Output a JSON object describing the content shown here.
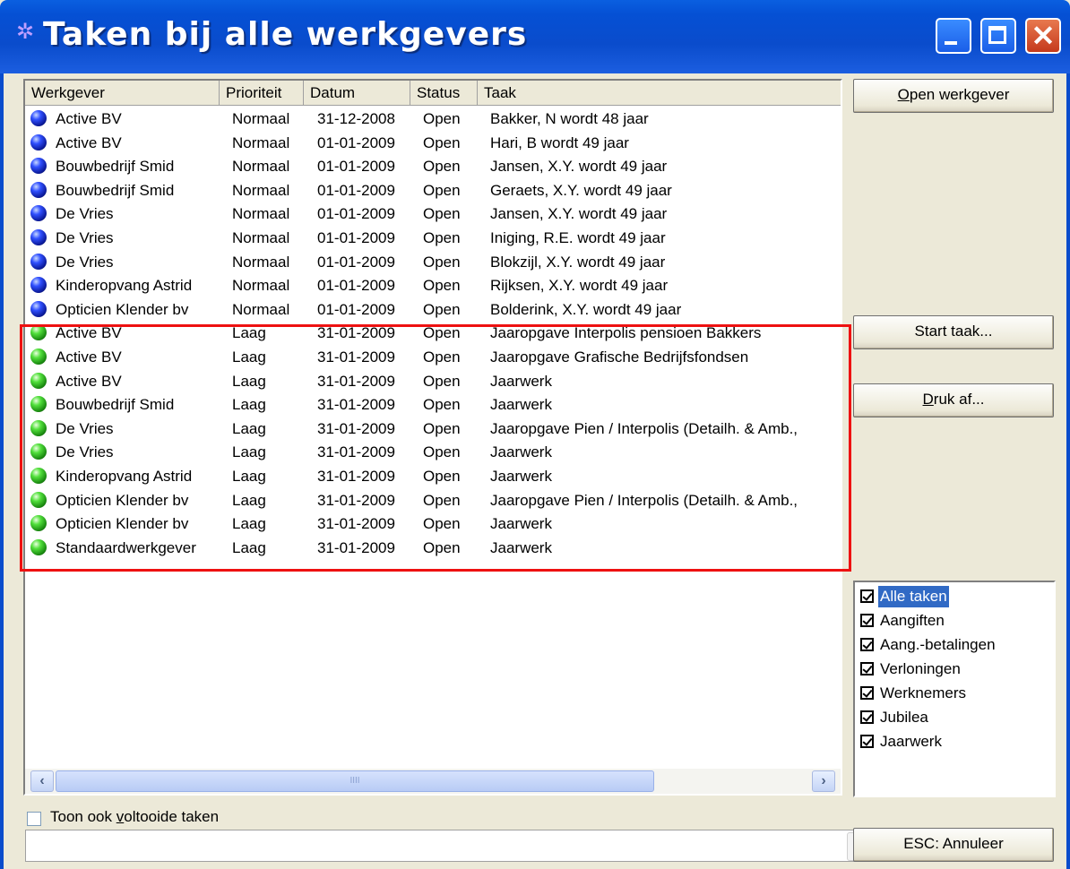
{
  "window": {
    "title": "Taken bij alle werkgevers"
  },
  "columns": [
    "Werkgever",
    "Prioriteit",
    "Datum",
    "Status",
    "Taak"
  ],
  "rows": [
    {
      "werkgever": "Active BV",
      "prioriteit": "Normaal",
      "datum": "31-12-2008",
      "status": "Open",
      "taak": "Bakker, N wordt 48 jaar",
      "icon": "blue-ball-icon"
    },
    {
      "werkgever": "Active BV",
      "prioriteit": "Normaal",
      "datum": "01-01-2009",
      "status": "Open",
      "taak": "Hari, B wordt 49 jaar",
      "icon": "blue-ball-icon"
    },
    {
      "werkgever": "Bouwbedrijf Smid",
      "prioriteit": "Normaal",
      "datum": "01-01-2009",
      "status": "Open",
      "taak": "Jansen, X.Y. wordt 49 jaar",
      "icon": "blue-ball-icon"
    },
    {
      "werkgever": "Bouwbedrijf Smid",
      "prioriteit": "Normaal",
      "datum": "01-01-2009",
      "status": "Open",
      "taak": "Geraets, X.Y. wordt 49 jaar",
      "icon": "blue-ball-icon"
    },
    {
      "werkgever": "De Vries",
      "prioriteit": "Normaal",
      "datum": "01-01-2009",
      "status": "Open",
      "taak": "Jansen, X.Y. wordt 49 jaar",
      "icon": "blue-ball-icon"
    },
    {
      "werkgever": "De Vries",
      "prioriteit": "Normaal",
      "datum": "01-01-2009",
      "status": "Open",
      "taak": "Iniging, R.E. wordt 49 jaar",
      "icon": "blue-ball-icon"
    },
    {
      "werkgever": "De Vries",
      "prioriteit": "Normaal",
      "datum": "01-01-2009",
      "status": "Open",
      "taak": "Blokzijl, X.Y. wordt 49 jaar",
      "icon": "blue-ball-icon"
    },
    {
      "werkgever": "Kinderopvang Astrid",
      "prioriteit": "Normaal",
      "datum": "01-01-2009",
      "status": "Open",
      "taak": "Rijksen, X.Y. wordt 49 jaar",
      "icon": "blue-ball-icon"
    },
    {
      "werkgever": "Opticien Klender bv",
      "prioriteit": "Normaal",
      "datum": "01-01-2009",
      "status": "Open",
      "taak": "Bolderink, X.Y. wordt 49 jaar",
      "icon": "blue-ball-icon"
    },
    {
      "werkgever": "Active BV",
      "prioriteit": "Laag",
      "datum": "31-01-2009",
      "status": "Open",
      "taak": "Jaaropgave Interpolis pensioen Bakkers",
      "icon": "green-ball-icon"
    },
    {
      "werkgever": "Active BV",
      "prioriteit": "Laag",
      "datum": "31-01-2009",
      "status": "Open",
      "taak": "Jaaropgave Grafische Bedrijfsfondsen",
      "icon": "green-ball-icon"
    },
    {
      "werkgever": "Active BV",
      "prioriteit": "Laag",
      "datum": "31-01-2009",
      "status": "Open",
      "taak": "Jaarwerk",
      "icon": "green-ball-icon"
    },
    {
      "werkgever": "Bouwbedrijf Smid",
      "prioriteit": "Laag",
      "datum": "31-01-2009",
      "status": "Open",
      "taak": "Jaarwerk",
      "icon": "green-ball-icon"
    },
    {
      "werkgever": "De Vries",
      "prioriteit": "Laag",
      "datum": "31-01-2009",
      "status": "Open",
      "taak": "Jaaropgave Pien / Interpolis (Detailh. & Amb.,",
      "icon": "green-ball-icon"
    },
    {
      "werkgever": "De Vries",
      "prioriteit": "Laag",
      "datum": "31-01-2009",
      "status": "Open",
      "taak": "Jaarwerk",
      "icon": "green-ball-icon"
    },
    {
      "werkgever": "Kinderopvang Astrid",
      "prioriteit": "Laag",
      "datum": "31-01-2009",
      "status": "Open",
      "taak": "Jaarwerk",
      "icon": "green-ball-icon"
    },
    {
      "werkgever": "Opticien Klender bv",
      "prioriteit": "Laag",
      "datum": "31-01-2009",
      "status": "Open",
      "taak": "Jaaropgave Pien / Interpolis (Detailh. & Amb.,",
      "icon": "green-ball-icon"
    },
    {
      "werkgever": "Opticien Klender bv",
      "prioriteit": "Laag",
      "datum": "31-01-2009",
      "status": "Open",
      "taak": "Jaarwerk",
      "icon": "green-ball-icon"
    },
    {
      "werkgever": "Standaardwerkgever",
      "prioriteit": "Laag",
      "datum": "31-01-2009",
      "status": "Open",
      "taak": "Jaarwerk",
      "icon": "green-ball-icon"
    }
  ],
  "buttons": {
    "open_werkgever": {
      "mnemonic": "O",
      "rest": "pen werkgever"
    },
    "start_taak": "Start taak...",
    "druk_af": {
      "mnemonic": "D",
      "rest": "ruk af..."
    },
    "annuleer": "ESC: Annuleer"
  },
  "filters": [
    {
      "label": "Alle taken",
      "checked": true,
      "selected": true
    },
    {
      "label": "Aangiften",
      "checked": true,
      "selected": false
    },
    {
      "label": "Aang.-betalingen",
      "checked": true,
      "selected": false
    },
    {
      "label": "Verloningen",
      "checked": true,
      "selected": false
    },
    {
      "label": "Werknemers",
      "checked": true,
      "selected": false
    },
    {
      "label": "Jubilea",
      "checked": true,
      "selected": false
    },
    {
      "label": "Jaarwerk",
      "checked": true,
      "selected": false
    }
  ],
  "bottom": {
    "show_completed": {
      "pre": "Toon ook ",
      "mnemonic": "v",
      "post": "oltooide taken",
      "checked": false
    },
    "combo_value": ""
  },
  "scrollbar": {
    "thumb_grip": "IIII"
  },
  "colors": {
    "highlight_border": "#ee1111",
    "selection": "#316ac5",
    "titlebar": "#0a4ccc"
  }
}
